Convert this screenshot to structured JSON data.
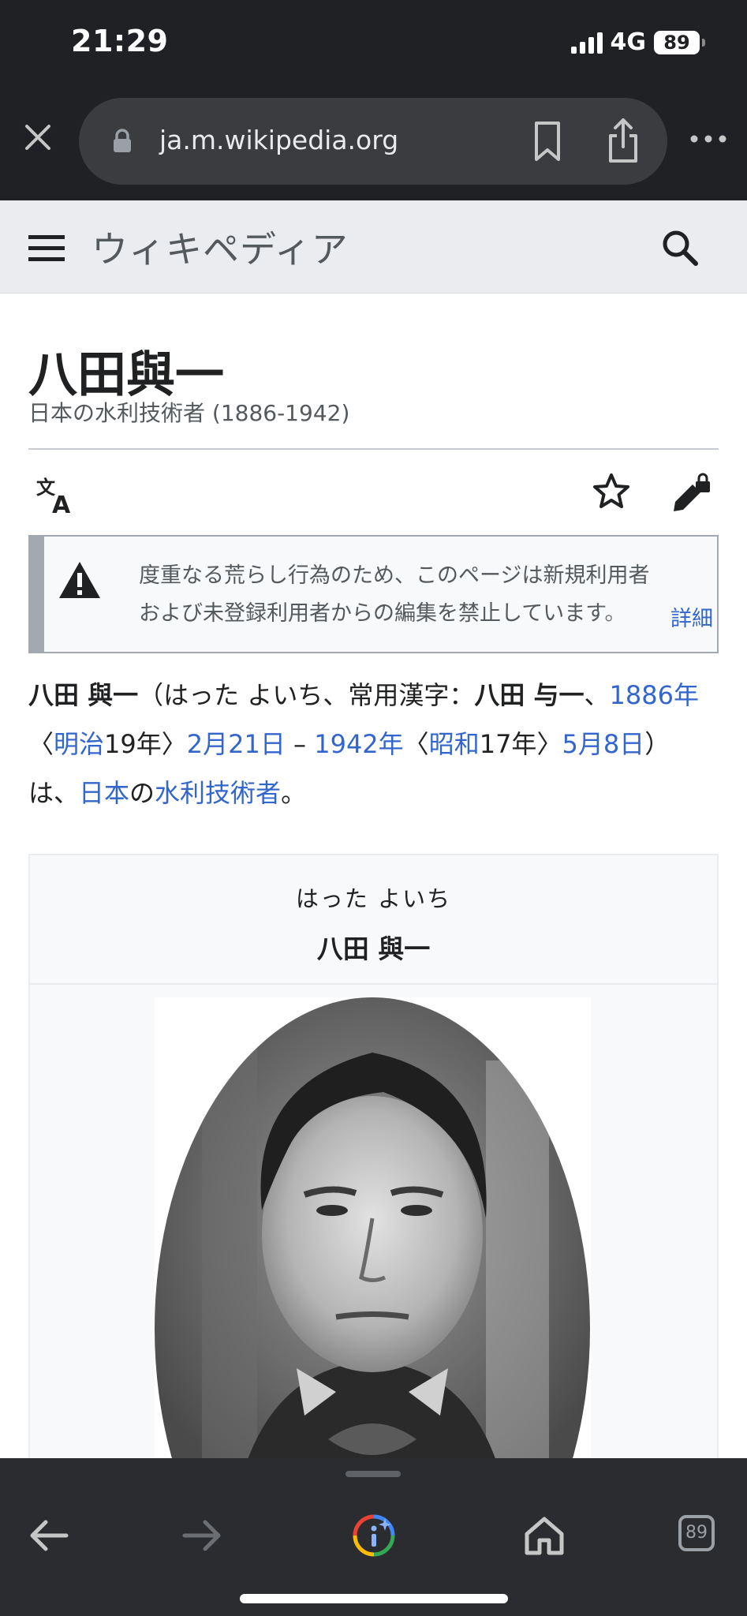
{
  "status_bar": {
    "time": "21:29",
    "network": "4G",
    "battery": "89"
  },
  "browser": {
    "url": "ja.m.wikipedia.org",
    "tab_count": "89",
    "icons": [
      "close-icon",
      "lock-icon",
      "bookmark-icon",
      "share-icon",
      "more-icon",
      "back-icon",
      "forward-icon",
      "lens-icon",
      "home-icon",
      "tabs-icon"
    ]
  },
  "wiki_header": {
    "logo": "ウィキペディア"
  },
  "article": {
    "title": "八田與一",
    "subtitle": "日本の水利技術者 (1886-1942)",
    "notice": {
      "line1": "度重なる荒らし行為のため、このページは新規利用者",
      "line2": "および未登録利用者からの編集を禁止しています。",
      "more_link": "詳細"
    },
    "lead": {
      "name_bold": "八田 與一",
      "paren_open": "（はった よいち、常用漢字：",
      "name_alt_bold": "八田 与一",
      "sep1": "、",
      "link_1886": "1886年",
      "br_open1": "〈",
      "link_meiji": "明治",
      "meiji_year": "19年",
      "br_close1": "〉",
      "link_feb21": "2月21日",
      "dash": " – ",
      "link_1942": "1942年",
      "br_open2": "〈",
      "link_showa": "昭和",
      "showa_year": "17年",
      "br_close2": "〉",
      "link_may8": "5月8日",
      "paren_close": "）は、",
      "link_japan": "日本",
      "no": "の",
      "link_engineer": "水利技術者",
      "period": "。"
    },
    "infobox": {
      "kana": "はった よいち",
      "name": "八田 與一"
    }
  },
  "colors": {
    "chrome_bg": "#202124",
    "toolbar_bg": "#2b2c2f",
    "link": "#3366cc",
    "notice_border": "#a2a9b1",
    "header_bg": "#eaecf0"
  }
}
